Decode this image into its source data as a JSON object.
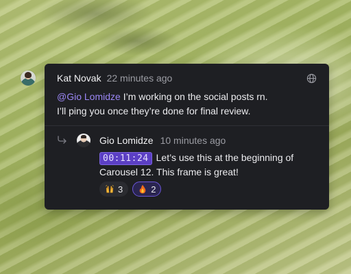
{
  "comment": {
    "author": "Kat Novak",
    "time": "22 minutes ago",
    "mention": "@Gio Lomidze",
    "text_line1": " I’m working on the social posts rn.",
    "text_line2": "I’ll ping you once they’re done for final review.",
    "visibility_icon": "globe-icon"
  },
  "reply": {
    "author": "Gio Lomidze",
    "time": "10 minutes ago",
    "timestamp": "00:11:24",
    "text": "Let’s use this at the beginning of Carousel 12. This frame is great!",
    "reactions": [
      {
        "emoji": "raised-hands",
        "count": "3",
        "active": false
      },
      {
        "emoji": "fire",
        "count": "2",
        "active": true
      }
    ]
  },
  "colors": {
    "card_bg": "#1e1f23",
    "mention": "#9b87f5",
    "timestamp_bg": "#5b3fc4",
    "reaction_active_border": "#6a55d8"
  }
}
